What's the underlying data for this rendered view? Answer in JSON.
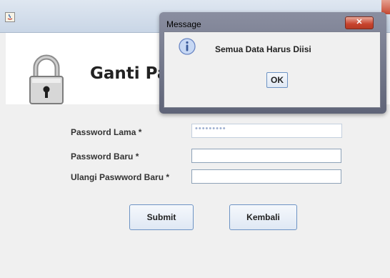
{
  "window": {
    "title": ""
  },
  "header": {
    "title": "Ganti Pa"
  },
  "form": {
    "fields": [
      {
        "label": "Password Lama *",
        "value": "•••••••••",
        "placeholder": ""
      },
      {
        "label": "Password Baru *",
        "value": "",
        "placeholder": ""
      },
      {
        "label": "Ulangi Paswword Baru *",
        "value": "",
        "placeholder": ""
      }
    ],
    "submit_label": "Submit",
    "back_label": "Kembali"
  },
  "dialog": {
    "title": "Message",
    "close_glyph": "✕",
    "message": "Semua Data Harus Diisi",
    "ok_label": "OK"
  },
  "icons": {
    "app": "java-app-icon",
    "lock": "padlock-icon",
    "info": "info-icon"
  }
}
